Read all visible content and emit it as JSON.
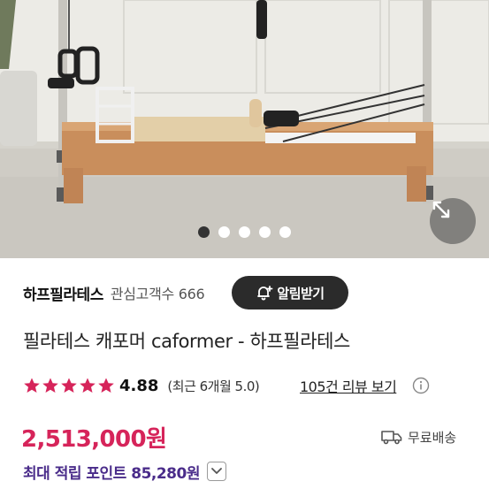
{
  "photo": {
    "slides_total": 5,
    "active_slide": 1,
    "expand_icon": "expand-arrows-icon"
  },
  "seller": {
    "name": "하프필라테스",
    "follower_label": "관심고객수 666",
    "alert_button": "알림받기",
    "alert_icon": "bell-plus-icon"
  },
  "product": {
    "title": "필라테스 캐포머 caformer - 하프필라테스"
  },
  "rating": {
    "score": "4.88",
    "stars": 5,
    "recent": "(최근 6개월 5.0)",
    "review_link": "105건 리뷰 보기",
    "star_color": "#d6245a"
  },
  "price": {
    "amount": "2,513,000원",
    "shipping": "무료배송",
    "color": "#d6245a"
  },
  "points": {
    "label": "최대 적립 포인트 85,280원",
    "color": "#4a2c8a"
  }
}
